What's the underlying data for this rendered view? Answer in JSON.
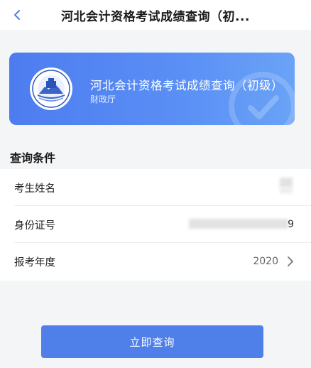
{
  "navbar": {
    "title": "河北会计资格考试成绩查询（初..."
  },
  "banner": {
    "title": "河北会计资格考试成绩查询（初级）",
    "subtitle": "财政厅"
  },
  "section": {
    "title": "查询条件"
  },
  "form": {
    "name_label": "考生姓名",
    "id_label": "身份证号",
    "id_visible_tail": "9",
    "year_label": "报考年度",
    "year_value": "2020"
  },
  "submit": {
    "label": "立即查询"
  },
  "colors": {
    "accent": "#4f7fe9",
    "banner_start": "#4d7cf0",
    "banner_end": "#6aa3f7"
  }
}
